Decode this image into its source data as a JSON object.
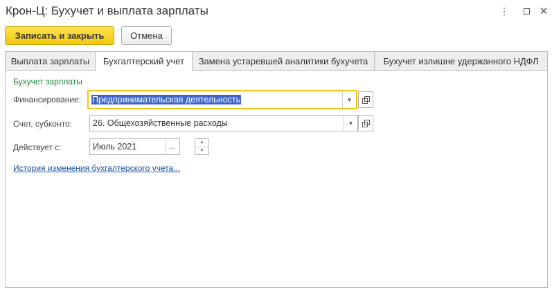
{
  "window": {
    "title": "Крон-Ц: Бухучет и выплата зарплаты",
    "more_glyph": "⋮",
    "close_glyph": "✕"
  },
  "toolbar": {
    "save_close_label": "Записать и закрыть",
    "cancel_label": "Отмена"
  },
  "tabs": [
    {
      "label": "Выплата зарплаты"
    },
    {
      "label": "Бухгалтерский учет",
      "active": true
    },
    {
      "label": "Замена устаревшей аналитики бухучета"
    },
    {
      "label": "Бухучет излишне удержанного НДФЛ"
    }
  ],
  "form": {
    "section_title": "Бухучет зарплаты",
    "financing": {
      "label": "Финансирование:",
      "value": "Предпринимательская деятельность"
    },
    "account": {
      "label": "Счет, субконто:",
      "value": "26. Общехозяйственные расходы"
    },
    "effective": {
      "label": "Действует с:",
      "value": "Июль 2021",
      "dots": "..."
    },
    "history_link": "История изменения бухгалтерского учета..."
  },
  "icons": {
    "dropdown": "chevron-down-icon",
    "open": "open-in-window-icon",
    "spin_up": "chevron-up-icon",
    "spin_down": "chevron-down-icon"
  },
  "colors": {
    "primary_button": "#f3c70f",
    "focus_border": "#f0c417",
    "section_title": "#1e8a3a",
    "link": "#1a4fa0",
    "selection": "#3d66c8"
  }
}
